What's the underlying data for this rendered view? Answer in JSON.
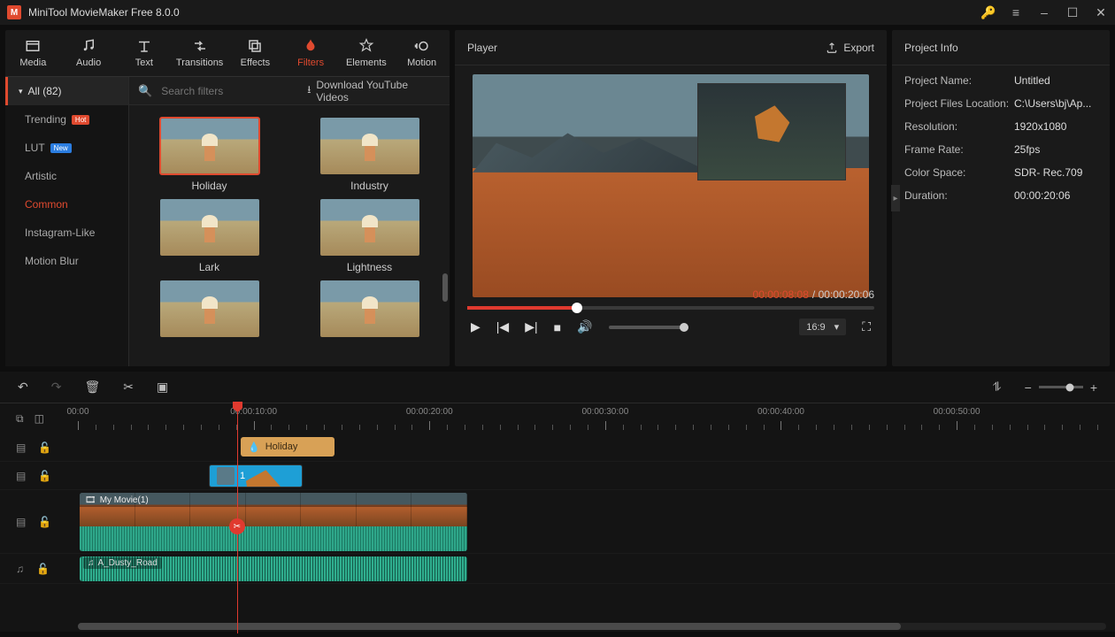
{
  "app": {
    "title": "MiniTool MovieMaker Free 8.0.0"
  },
  "tabs": {
    "media": "Media",
    "audio": "Audio",
    "text": "Text",
    "transitions": "Transitions",
    "effects": "Effects",
    "filters": "Filters",
    "elements": "Elements",
    "motion": "Motion"
  },
  "sidebar": {
    "all": "All (82)",
    "items": [
      {
        "label": "Trending",
        "badge": "Hot"
      },
      {
        "label": "LUT",
        "badge": "New"
      },
      {
        "label": "Artistic"
      },
      {
        "label": "Common",
        "active": true
      },
      {
        "label": "Instagram-Like"
      },
      {
        "label": "Motion Blur"
      }
    ]
  },
  "search": {
    "placeholder": "Search filters",
    "download": "Download YouTube Videos"
  },
  "filters": [
    {
      "label": "Holiday",
      "selected": true
    },
    {
      "label": "Industry"
    },
    {
      "label": "Lark"
    },
    {
      "label": "Lightness"
    },
    {
      "label": ""
    },
    {
      "label": ""
    }
  ],
  "player": {
    "title": "Player",
    "export": "Export",
    "current": "00:00:08:08",
    "duration": "00:00:20:06",
    "aspect": "16:9"
  },
  "project": {
    "title": "Project Info",
    "rows": [
      {
        "k": "Project Name:",
        "v": "Untitled"
      },
      {
        "k": "Project Files Location:",
        "v": "C:\\Users\\bj\\Ap..."
      },
      {
        "k": "Resolution:",
        "v": "1920x1080"
      },
      {
        "k": "Frame Rate:",
        "v": "25fps"
      },
      {
        "k": "Color Space:",
        "v": "SDR- Rec.709"
      },
      {
        "k": "Duration:",
        "v": "00:00:20:06"
      }
    ]
  },
  "timeline": {
    "ruler": [
      "00:00",
      "00:00:10:00",
      "00:00:20:00",
      "00:00:30:00",
      "00:00:40:00",
      "00:00:50:00"
    ],
    "clips": {
      "filter": "Holiday",
      "pip": "1",
      "video": "My Movie(1)",
      "audio": "A_Dusty_Road"
    }
  }
}
